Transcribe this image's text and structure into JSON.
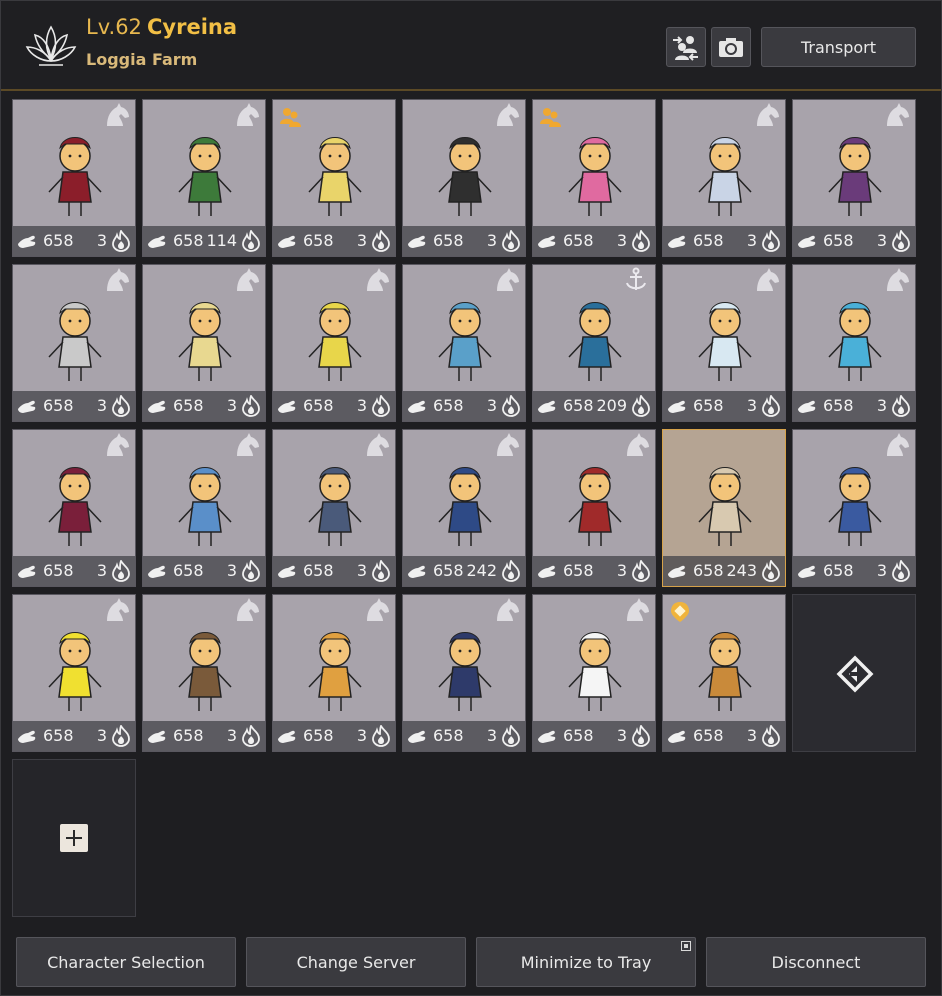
{
  "header": {
    "level_prefix": "Lv.",
    "level": "62",
    "character_name": "Cyreina",
    "family_name": "Loggia Farm",
    "transport_label": "Transport"
  },
  "icons": {
    "logo": "lotus-logo-icon",
    "swap": "swap-characters-icon",
    "camera": "camera-icon",
    "energy_ap": "hand-energy-icon",
    "contribution": "flame-icon",
    "horse": "horse-icon",
    "group": "group-icon",
    "anchor": "anchor-icon",
    "location": "location-pin-icon",
    "next_page": "next-page-icon",
    "add": "plus-icon"
  },
  "colors": {
    "accent_gold": "#f2bf45",
    "card_bg": "#a8a3ab",
    "selected_border": "#d6a24a"
  },
  "characters": [
    {
      "ap": "658",
      "energy": "3",
      "marker": "horse"
    },
    {
      "ap": "658",
      "energy": "114",
      "marker": "horse"
    },
    {
      "ap": "658",
      "energy": "3",
      "marker": "group"
    },
    {
      "ap": "658",
      "energy": "3",
      "marker": "horse"
    },
    {
      "ap": "658",
      "energy": "3",
      "marker": "group"
    },
    {
      "ap": "658",
      "energy": "3",
      "marker": "horse"
    },
    {
      "ap": "658",
      "energy": "3",
      "marker": "horse"
    },
    {
      "ap": "658",
      "energy": "3",
      "marker": "horse"
    },
    {
      "ap": "658",
      "energy": "3",
      "marker": "horse"
    },
    {
      "ap": "658",
      "energy": "3",
      "marker": "horse"
    },
    {
      "ap": "658",
      "energy": "3",
      "marker": "horse"
    },
    {
      "ap": "658",
      "energy": "209",
      "marker": "anchor"
    },
    {
      "ap": "658",
      "energy": "3",
      "marker": "horse"
    },
    {
      "ap": "658",
      "energy": "3",
      "marker": "horse"
    },
    {
      "ap": "658",
      "energy": "3",
      "marker": "horse"
    },
    {
      "ap": "658",
      "energy": "3",
      "marker": "horse"
    },
    {
      "ap": "658",
      "energy": "3",
      "marker": "horse"
    },
    {
      "ap": "658",
      "energy": "242",
      "marker": "horse"
    },
    {
      "ap": "658",
      "energy": "3",
      "marker": "horse"
    },
    {
      "ap": "658",
      "energy": "243",
      "marker": "none",
      "selected": true
    },
    {
      "ap": "658",
      "energy": "3",
      "marker": "horse"
    },
    {
      "ap": "658",
      "energy": "3",
      "marker": "horse"
    },
    {
      "ap": "658",
      "energy": "3",
      "marker": "horse"
    },
    {
      "ap": "658",
      "energy": "3",
      "marker": "horse"
    },
    {
      "ap": "658",
      "energy": "3",
      "marker": "horse"
    },
    {
      "ap": "658",
      "energy": "3",
      "marker": "horse"
    },
    {
      "ap": "658",
      "energy": "3",
      "marker": "location"
    }
  ],
  "footer": {
    "character_selection": "Character Selection",
    "change_server": "Change Server",
    "minimize_to_tray": "Minimize to Tray",
    "disconnect": "Disconnect"
  }
}
